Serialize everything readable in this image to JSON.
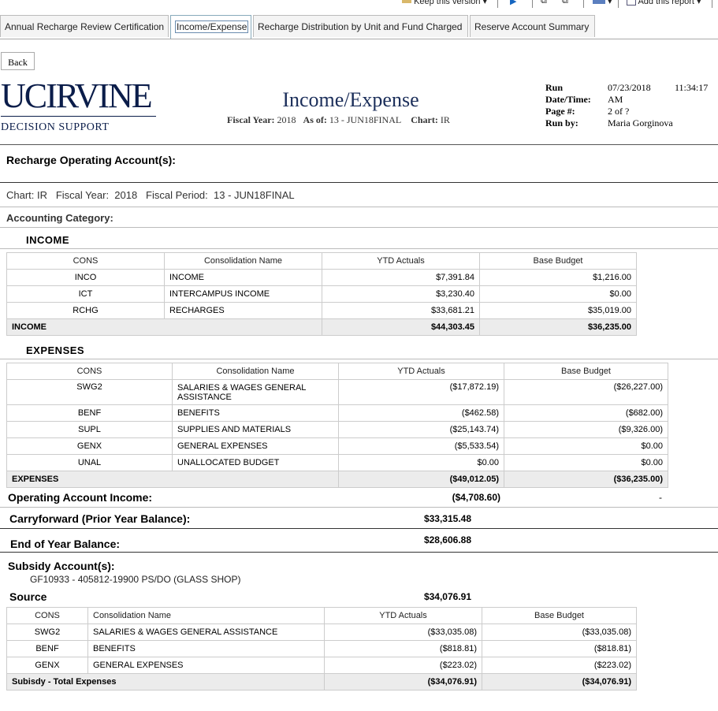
{
  "toolbar": {
    "keep_version": "Keep this version",
    "add_report": "Add this report"
  },
  "tabs": [
    {
      "label": "Annual Recharge Review Certification"
    },
    {
      "label": "Income/Expense"
    },
    {
      "label": "Recharge Distribution by Unit and Fund Charged"
    },
    {
      "label": "Reserve Account Summary"
    }
  ],
  "back_label": "Back",
  "logo": {
    "line1": "UCIRVINE",
    "line2": "DECISION SUPPORT"
  },
  "report": {
    "title": "Income/Expense",
    "fy_label": "Fiscal Year:",
    "fy_value": "2018",
    "asof_label": "As of:",
    "asof_value": "13 - JUN18FINAL",
    "chart_label": "Chart:",
    "chart_value": "IR"
  },
  "run_info": {
    "run_label": "Run Date/Time:",
    "run_date": "07/23/2018",
    "run_time": "11:34:17",
    "run_ampm": "AM",
    "page_label": "Page #:",
    "page_value": "2 of ?",
    "runby_label": "Run by:",
    "runby_value": "Maria Gorginova"
  },
  "section_title": "Recharge Operating Account(s):",
  "context_line": "Chart: IR   Fiscal Year:  2018   Fiscal Period:  13 - JUN18FINAL",
  "accounting_category": "Accounting Category:",
  "income": {
    "heading": "INCOME",
    "headers": [
      "CONS",
      "Consolidation Name",
      "YTD Actuals",
      "Base Budget"
    ],
    "rows": [
      [
        "INCO",
        "INCOME",
        "$7,391.84",
        "$1,216.00"
      ],
      [
        "ICT",
        "INTERCAMPUS INCOME",
        "$3,230.40",
        "$0.00"
      ],
      [
        "RCHG",
        "RECHARGES",
        "$33,681.21",
        "$35,019.00"
      ]
    ],
    "total": [
      "INCOME",
      "$44,303.45",
      "$36,235.00"
    ]
  },
  "expenses": {
    "heading": "EXPENSES",
    "headers": [
      "CONS",
      "Consolidation Name",
      "YTD Actuals",
      "Base Budget"
    ],
    "rows": [
      [
        "SWG2",
        "SALARIES & WAGES GENERAL ASSISTANCE",
        "($17,872.19)",
        "($26,227.00)"
      ],
      [
        "BENF",
        "BENEFITS",
        "($462.58)",
        "($682.00)"
      ],
      [
        "SUPL",
        "SUPPLIES AND MATERIALS",
        "($25,143.74)",
        "($9,326.00)"
      ],
      [
        "GENX",
        "GENERAL EXPENSES",
        "($5,533.54)",
        "$0.00"
      ],
      [
        "UNAL",
        "UNALLOCATED BUDGET",
        "$0.00",
        "$0.00"
      ]
    ],
    "total": [
      "EXPENSES",
      "($49,012.05)",
      "($36,235.00)"
    ]
  },
  "summary": {
    "op_income_label": "Operating Account Income:",
    "op_income_value": "($4,708.60)",
    "op_income_budget": "-",
    "carry_label": "Carryforward (Prior Year Balance):",
    "carry_value": "$33,315.48",
    "eoy_label": "End of Year Balance:",
    "eoy_value": "$28,606.88"
  },
  "subsidy": {
    "title": "Subsidy Account(s):",
    "account": "GF10933 - 405812-19900 PS/DO (GLASS SHOP)",
    "source_label": "Source",
    "source_value": "$34,076.91",
    "headers": [
      "CONS",
      "Consolidation Name",
      "YTD Actuals",
      "Base Budget"
    ],
    "rows": [
      [
        "SWG2",
        "SALARIES & WAGES GENERAL ASSISTANCE",
        "($33,035.08)",
        "($33,035.08)"
      ],
      [
        "BENF",
        "BENEFITS",
        "($818.81)",
        "($818.81)"
      ],
      [
        "GENX",
        "GENERAL EXPENSES",
        "($223.02)",
        "($223.02)"
      ]
    ],
    "total": [
      "Subisdy - Total Expenses",
      "($34,076.91)",
      "($34,076.91)"
    ]
  }
}
